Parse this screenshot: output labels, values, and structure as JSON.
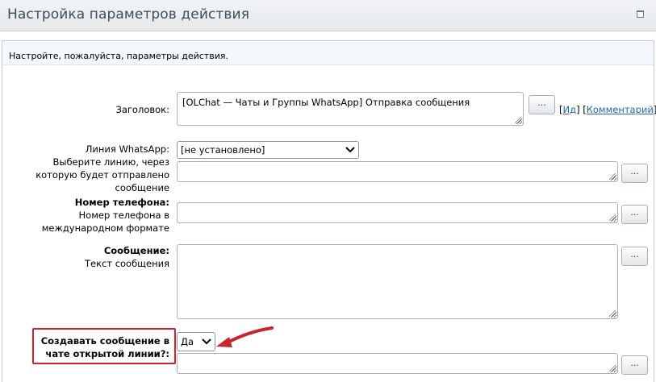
{
  "window": {
    "title": "Настройка параметров действия"
  },
  "hint": {
    "text": "Настройте, пожалуйста, параметры действия."
  },
  "fields": {
    "title": {
      "label": "Заголовок:",
      "value": "[OLChat — Чаты и Группы WhatsApp] Отправка сообщения",
      "dots_label": "...",
      "link_id": "Ид",
      "link_comment": "Комментарий",
      "bracket_open": "[",
      "bracket_close": "]",
      "separator": "] ["
    },
    "line": {
      "label": "Линия WhatsApp:",
      "description": "Выберите линию, через которую будет отправлено сообщение",
      "selected": "[не установлено]",
      "value": "",
      "dots_label": "..."
    },
    "phone": {
      "label": "Номер телефона:",
      "description": "Номер телефона в международном формате",
      "value": "",
      "dots_label": "..."
    },
    "message": {
      "label": "Сообщение:",
      "description": "Текст сообщения",
      "value": "",
      "dots_label": "..."
    },
    "create_chat": {
      "label": "Создавать сообщение в чате открытой линии?:",
      "selected": "Да",
      "value": "",
      "dots_label": "..."
    }
  },
  "colors": {
    "accent_red": "#c8252c",
    "link_blue": "#2067b0"
  }
}
